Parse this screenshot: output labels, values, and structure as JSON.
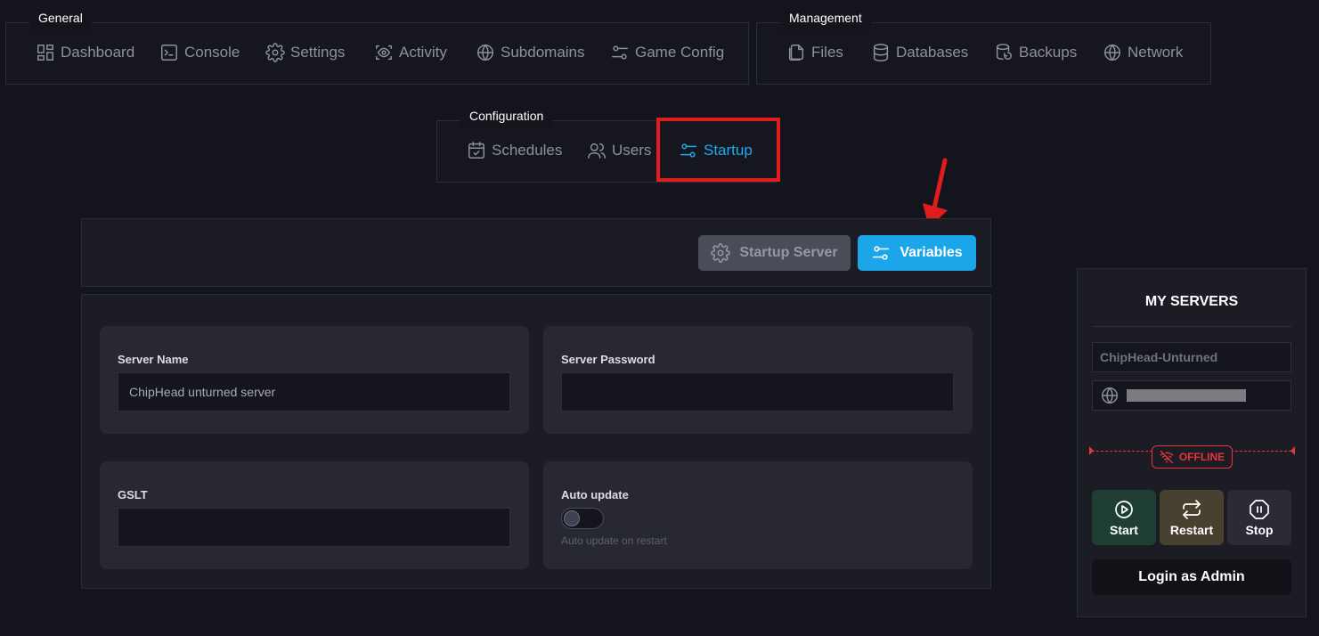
{
  "nav": {
    "general": {
      "label": "General",
      "items": [
        {
          "label": "Dashboard",
          "icon": "dashboard-icon"
        },
        {
          "label": "Console",
          "icon": "terminal-icon"
        },
        {
          "label": "Settings",
          "icon": "gear-icon"
        },
        {
          "label": "Activity",
          "icon": "activity-icon"
        },
        {
          "label": "Subdomains",
          "icon": "globe-icon"
        },
        {
          "label": "Game Config",
          "icon": "sliders-icon"
        }
      ]
    },
    "management": {
      "label": "Management",
      "items": [
        {
          "label": "Files",
          "icon": "files-icon"
        },
        {
          "label": "Databases",
          "icon": "database-icon"
        },
        {
          "label": "Backups",
          "icon": "backup-icon"
        },
        {
          "label": "Network",
          "icon": "globe-icon"
        }
      ]
    },
    "configuration": {
      "label": "Configuration",
      "items": [
        {
          "label": "Schedules",
          "icon": "calendar-icon"
        },
        {
          "label": "Users",
          "icon": "users-icon"
        },
        {
          "label": "Startup",
          "icon": "sliders-icon",
          "active": true
        }
      ]
    }
  },
  "toolbar": {
    "startup_server_label": "Startup Server",
    "variables_label": "Variables"
  },
  "variables": {
    "server_name": {
      "label": "Server Name",
      "value": "ChipHead unturned server"
    },
    "server_password": {
      "label": "Server Password",
      "value": ""
    },
    "gslt": {
      "label": "GSLT",
      "value": ""
    },
    "auto_update": {
      "label": "Auto update",
      "enabled": false,
      "helper": "Auto update on restart"
    }
  },
  "sidebar": {
    "title": "MY SERVERS",
    "server_name": "ChipHead-Unturned",
    "status": "OFFLINE",
    "controls": {
      "start": "Start",
      "restart": "Restart",
      "stop": "Stop"
    },
    "login_admin": "Login as Admin"
  },
  "colors": {
    "accent": "#1ba6ea",
    "offline": "#e8343c",
    "annotation": "#e01c1c"
  }
}
